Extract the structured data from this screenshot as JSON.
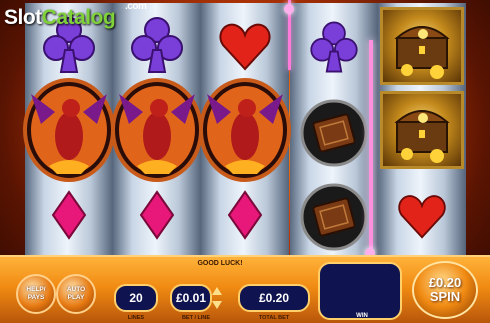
{
  "logo": {
    "part1": "Slot",
    "part2": "Catalog",
    "suffix": ".com"
  },
  "reels": [
    [
      "purple-club",
      "dragon",
      "dragon",
      "pink-diamond"
    ],
    [
      "purple-club",
      "dragon",
      "dragon",
      "pink-diamond"
    ],
    [
      "red-heart",
      "dragon",
      "dragon",
      "pink-diamond"
    ],
    [
      "purple-club",
      "spellbook",
      "spellbook"
    ],
    [
      "treasure-chest",
      "treasure-chest",
      "red-heart"
    ]
  ],
  "panel": {
    "message": "GOOD LUCK!",
    "help_button": "HELP/ PAYS",
    "autoplay_button": "AUTO PLAY",
    "lines_value": "20",
    "lines_caption": "LINES",
    "bet_value": "£0.01",
    "bet_caption": "BET / LINE",
    "total_value": "£0.20",
    "total_caption": "TOTAL BET",
    "win_caption": "WIN",
    "spin_amount": "£0.20",
    "spin_label": "SPIN"
  },
  "colors": {
    "panel": "#f08a12",
    "field_bg": "#0f1450",
    "payline": "#ff7ad9"
  }
}
